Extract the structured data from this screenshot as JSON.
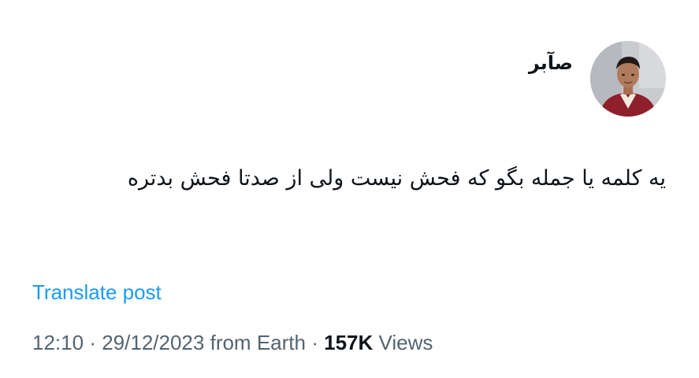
{
  "author": {
    "display_name": "صآبر",
    "avatar_icon": "user-avatar-photo"
  },
  "more_icon": "more-horizontal-icon",
  "post": {
    "text": "یه کلمه یا جمله بگو که فحش نیست ولی از صدتا فحش بدتره"
  },
  "translate": {
    "label": "Translate post"
  },
  "meta": {
    "time": "12:10",
    "separator": "·",
    "date": "29/12/2023",
    "source": "from Earth",
    "views_count": "157K",
    "views_label": "Views"
  },
  "colors": {
    "link": "#1d9bf0",
    "secondary_text": "#536471",
    "primary_text": "#0f1419"
  }
}
